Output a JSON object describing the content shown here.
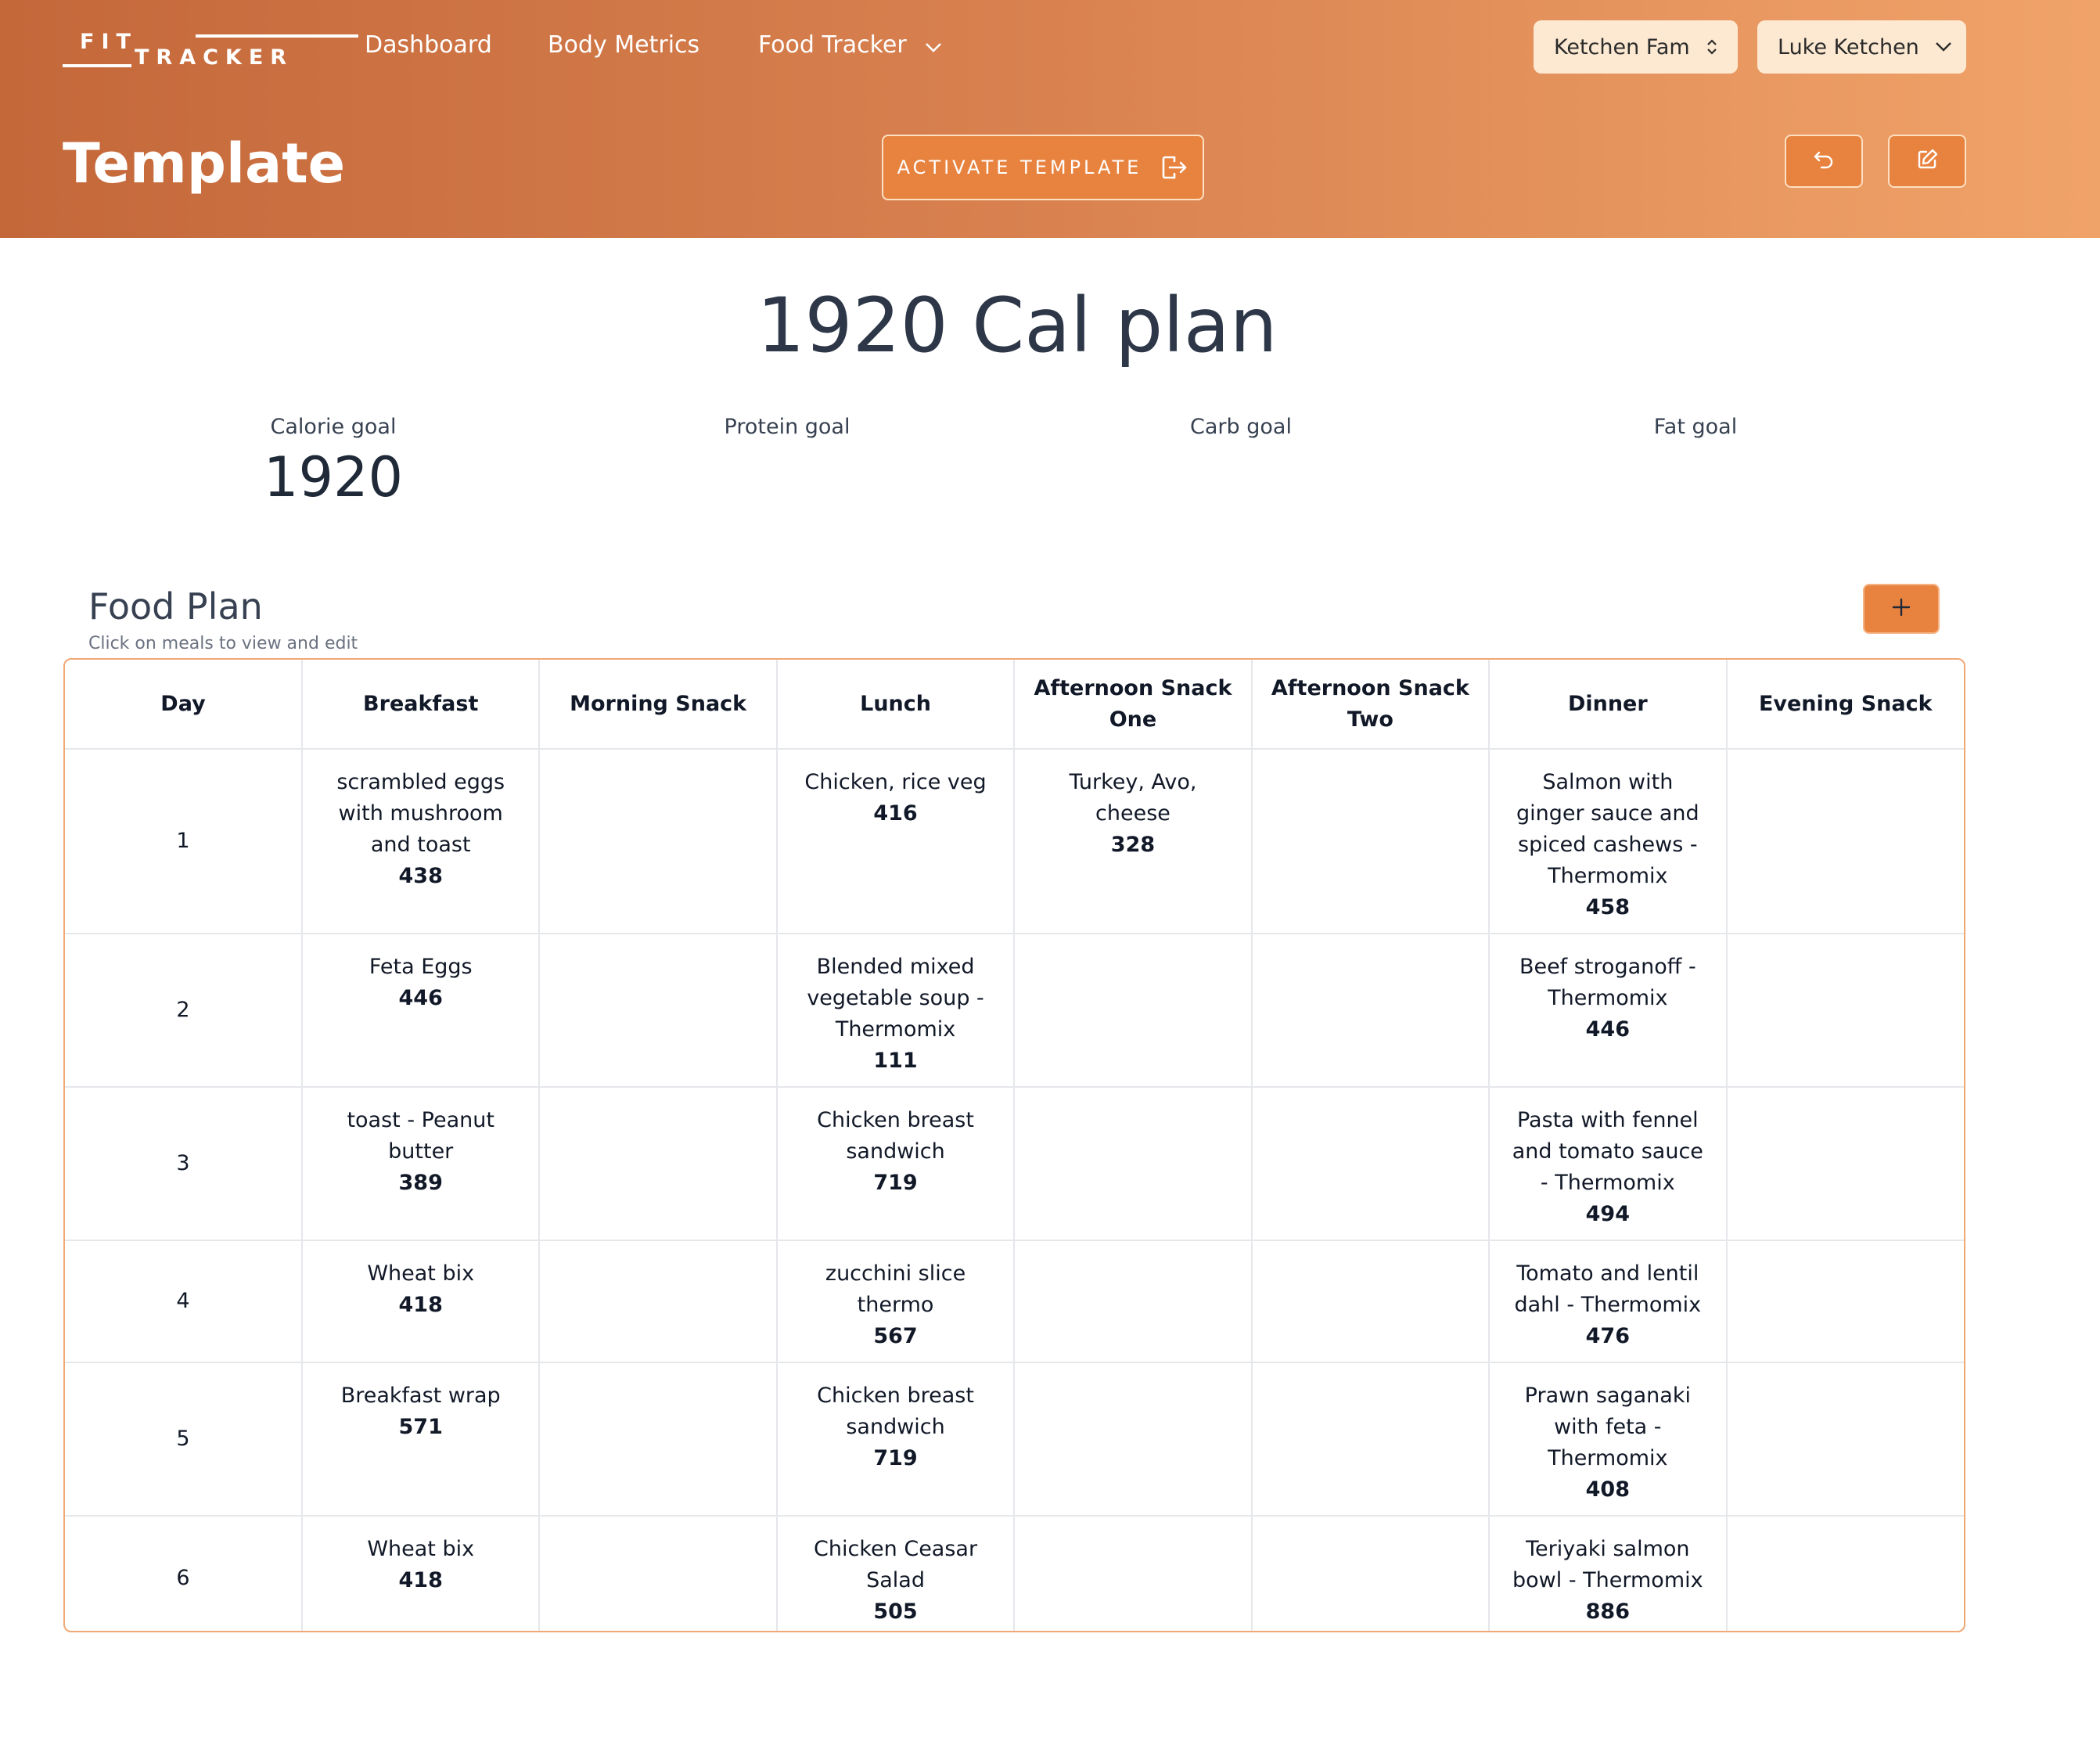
{
  "nav": {
    "logo_top": "FIT",
    "logo_bottom": "TRACKER",
    "items": [
      {
        "label": "Dashboard"
      },
      {
        "label": "Body Metrics"
      },
      {
        "label": "Food Tracker"
      }
    ],
    "family_select": "Ketchen Fam",
    "user_select": "Luke Ketchen"
  },
  "page": {
    "title": "Template",
    "activate_label": "ACTIVATE TEMPLATE"
  },
  "plan": {
    "name": "1920 Cal plan",
    "goals": [
      {
        "label": "Calorie goal",
        "value": "1920"
      },
      {
        "label": "Protein goal",
        "value": ""
      },
      {
        "label": "Carb goal",
        "value": ""
      },
      {
        "label": "Fat goal",
        "value": ""
      }
    ]
  },
  "food_plan": {
    "title": "Food Plan",
    "subtitle": "Click on meals to view and edit",
    "add_label": "+",
    "columns": [
      "Day",
      "Breakfast",
      "Morning Snack",
      "Lunch",
      "Afternoon Snack One",
      "Afternoon Snack Two",
      "Dinner",
      "Evening Snack"
    ],
    "rows": [
      {
        "day": "1",
        "meals": [
          {
            "name": "scrambled eggs with mushroom and toast",
            "cal": "438"
          },
          {
            "name": "",
            "cal": ""
          },
          {
            "name": "Chicken, rice veg",
            "cal": "416"
          },
          {
            "name": "Turkey, Avo, cheese",
            "cal": "328"
          },
          {
            "name": "",
            "cal": ""
          },
          {
            "name": "Salmon with ginger sauce and spiced cashews - Thermomix",
            "cal": "458"
          },
          {
            "name": "",
            "cal": ""
          }
        ]
      },
      {
        "day": "2",
        "meals": [
          {
            "name": "Feta Eggs",
            "cal": "446"
          },
          {
            "name": "",
            "cal": ""
          },
          {
            "name": "Blended mixed vegetable soup - Thermomix",
            "cal": "111"
          },
          {
            "name": "",
            "cal": ""
          },
          {
            "name": "",
            "cal": ""
          },
          {
            "name": "Beef stroganoff - Thermomix",
            "cal": "446"
          },
          {
            "name": "",
            "cal": ""
          }
        ]
      },
      {
        "day": "3",
        "meals": [
          {
            "name": "toast - Peanut butter",
            "cal": "389"
          },
          {
            "name": "",
            "cal": ""
          },
          {
            "name": "Chicken breast sandwich",
            "cal": "719"
          },
          {
            "name": "",
            "cal": ""
          },
          {
            "name": "",
            "cal": ""
          },
          {
            "name": "Pasta with fennel and tomato sauce - Thermomix",
            "cal": "494"
          },
          {
            "name": "",
            "cal": ""
          }
        ]
      },
      {
        "day": "4",
        "meals": [
          {
            "name": "Wheat bix",
            "cal": "418"
          },
          {
            "name": "",
            "cal": ""
          },
          {
            "name": "zucchini slice thermo",
            "cal": "567"
          },
          {
            "name": "",
            "cal": ""
          },
          {
            "name": "",
            "cal": ""
          },
          {
            "name": "Tomato and lentil dahl - Thermomix",
            "cal": "476"
          },
          {
            "name": "",
            "cal": ""
          }
        ]
      },
      {
        "day": "5",
        "meals": [
          {
            "name": "Breakfast wrap",
            "cal": "571"
          },
          {
            "name": "",
            "cal": ""
          },
          {
            "name": "Chicken breast sandwich",
            "cal": "719"
          },
          {
            "name": "",
            "cal": ""
          },
          {
            "name": "",
            "cal": ""
          },
          {
            "name": "Prawn saganaki with feta - Thermomix",
            "cal": "408"
          },
          {
            "name": "",
            "cal": ""
          }
        ]
      },
      {
        "day": "6",
        "meals": [
          {
            "name": "Wheat bix",
            "cal": "418"
          },
          {
            "name": "",
            "cal": ""
          },
          {
            "name": "Chicken Ceasar Salad",
            "cal": "505"
          },
          {
            "name": "",
            "cal": ""
          },
          {
            "name": "",
            "cal": ""
          },
          {
            "name": "Teriyaki salmon bowl - Thermomix",
            "cal": "886"
          },
          {
            "name": "",
            "cal": ""
          }
        ]
      }
    ]
  }
}
